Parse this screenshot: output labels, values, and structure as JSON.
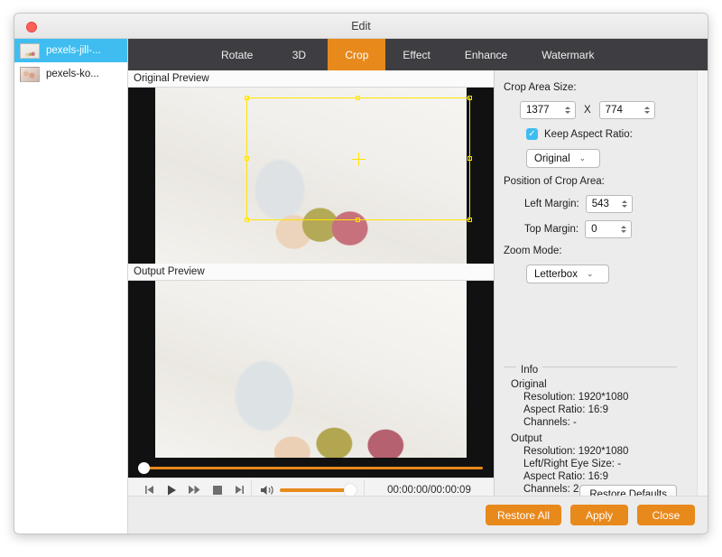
{
  "window": {
    "title": "Edit",
    "close_icon": "close-icon"
  },
  "sidebar": {
    "items": [
      {
        "label": "pexels-jill-...",
        "thumb": "thumbnail-icon",
        "selected": true
      },
      {
        "label": "pexels-ko...",
        "thumb": "thumbnail-icon",
        "selected": false
      }
    ]
  },
  "tabs": [
    {
      "label": "Rotate",
      "active": false
    },
    {
      "label": "3D",
      "active": false
    },
    {
      "label": "Crop",
      "active": true
    },
    {
      "label": "Effect",
      "active": false
    },
    {
      "label": "Enhance",
      "active": false
    },
    {
      "label": "Watermark",
      "active": false
    }
  ],
  "previews": {
    "original_label": "Original Preview",
    "output_label": "Output Preview"
  },
  "transport": {
    "previous_icon": "skip-previous-icon",
    "play_icon": "play-icon",
    "forward_icon": "fast-forward-icon",
    "stop_icon": "stop-icon",
    "next_icon": "skip-next-icon",
    "volume_icon": "volume-icon",
    "timecode": "00:00:00/00:00:09"
  },
  "crop_panel": {
    "crop_area_size_label": "Crop Area Size:",
    "width_value": "1377",
    "x_separator": "X",
    "height_value": "774",
    "keep_aspect_ratio_label": "Keep Aspect Ratio:",
    "keep_aspect_ratio_checked": true,
    "aspect_ratio_value": "Original",
    "position_label": "Position of Crop Area:",
    "left_margin_label": "Left Margin:",
    "left_margin_value": "543",
    "top_margin_label": "Top Margin:",
    "top_margin_value": "0",
    "zoom_mode_label": "Zoom Mode:",
    "zoom_mode_value": "Letterbox"
  },
  "info": {
    "title": "Info",
    "original_label": "Original",
    "original_items": [
      "Resolution: 1920*1080",
      "Aspect Ratio: 16:9",
      "Channels: -"
    ],
    "output_label": "Output",
    "output_items": [
      "Resolution: 1920*1080",
      "Left/Right Eye Size: -",
      "Aspect Ratio: 16:9",
      "Channels: 2"
    ],
    "restore_defaults_label": "Restore Defaults"
  },
  "footer": {
    "restore_all_label": "Restore All",
    "apply_label": "Apply",
    "close_label": "Close"
  },
  "colors": {
    "accent_orange": "#e8891c",
    "selection_blue": "#3fbdf0",
    "tabbar_dark": "#3e3e42",
    "crop_yellow": "#ffe500"
  }
}
